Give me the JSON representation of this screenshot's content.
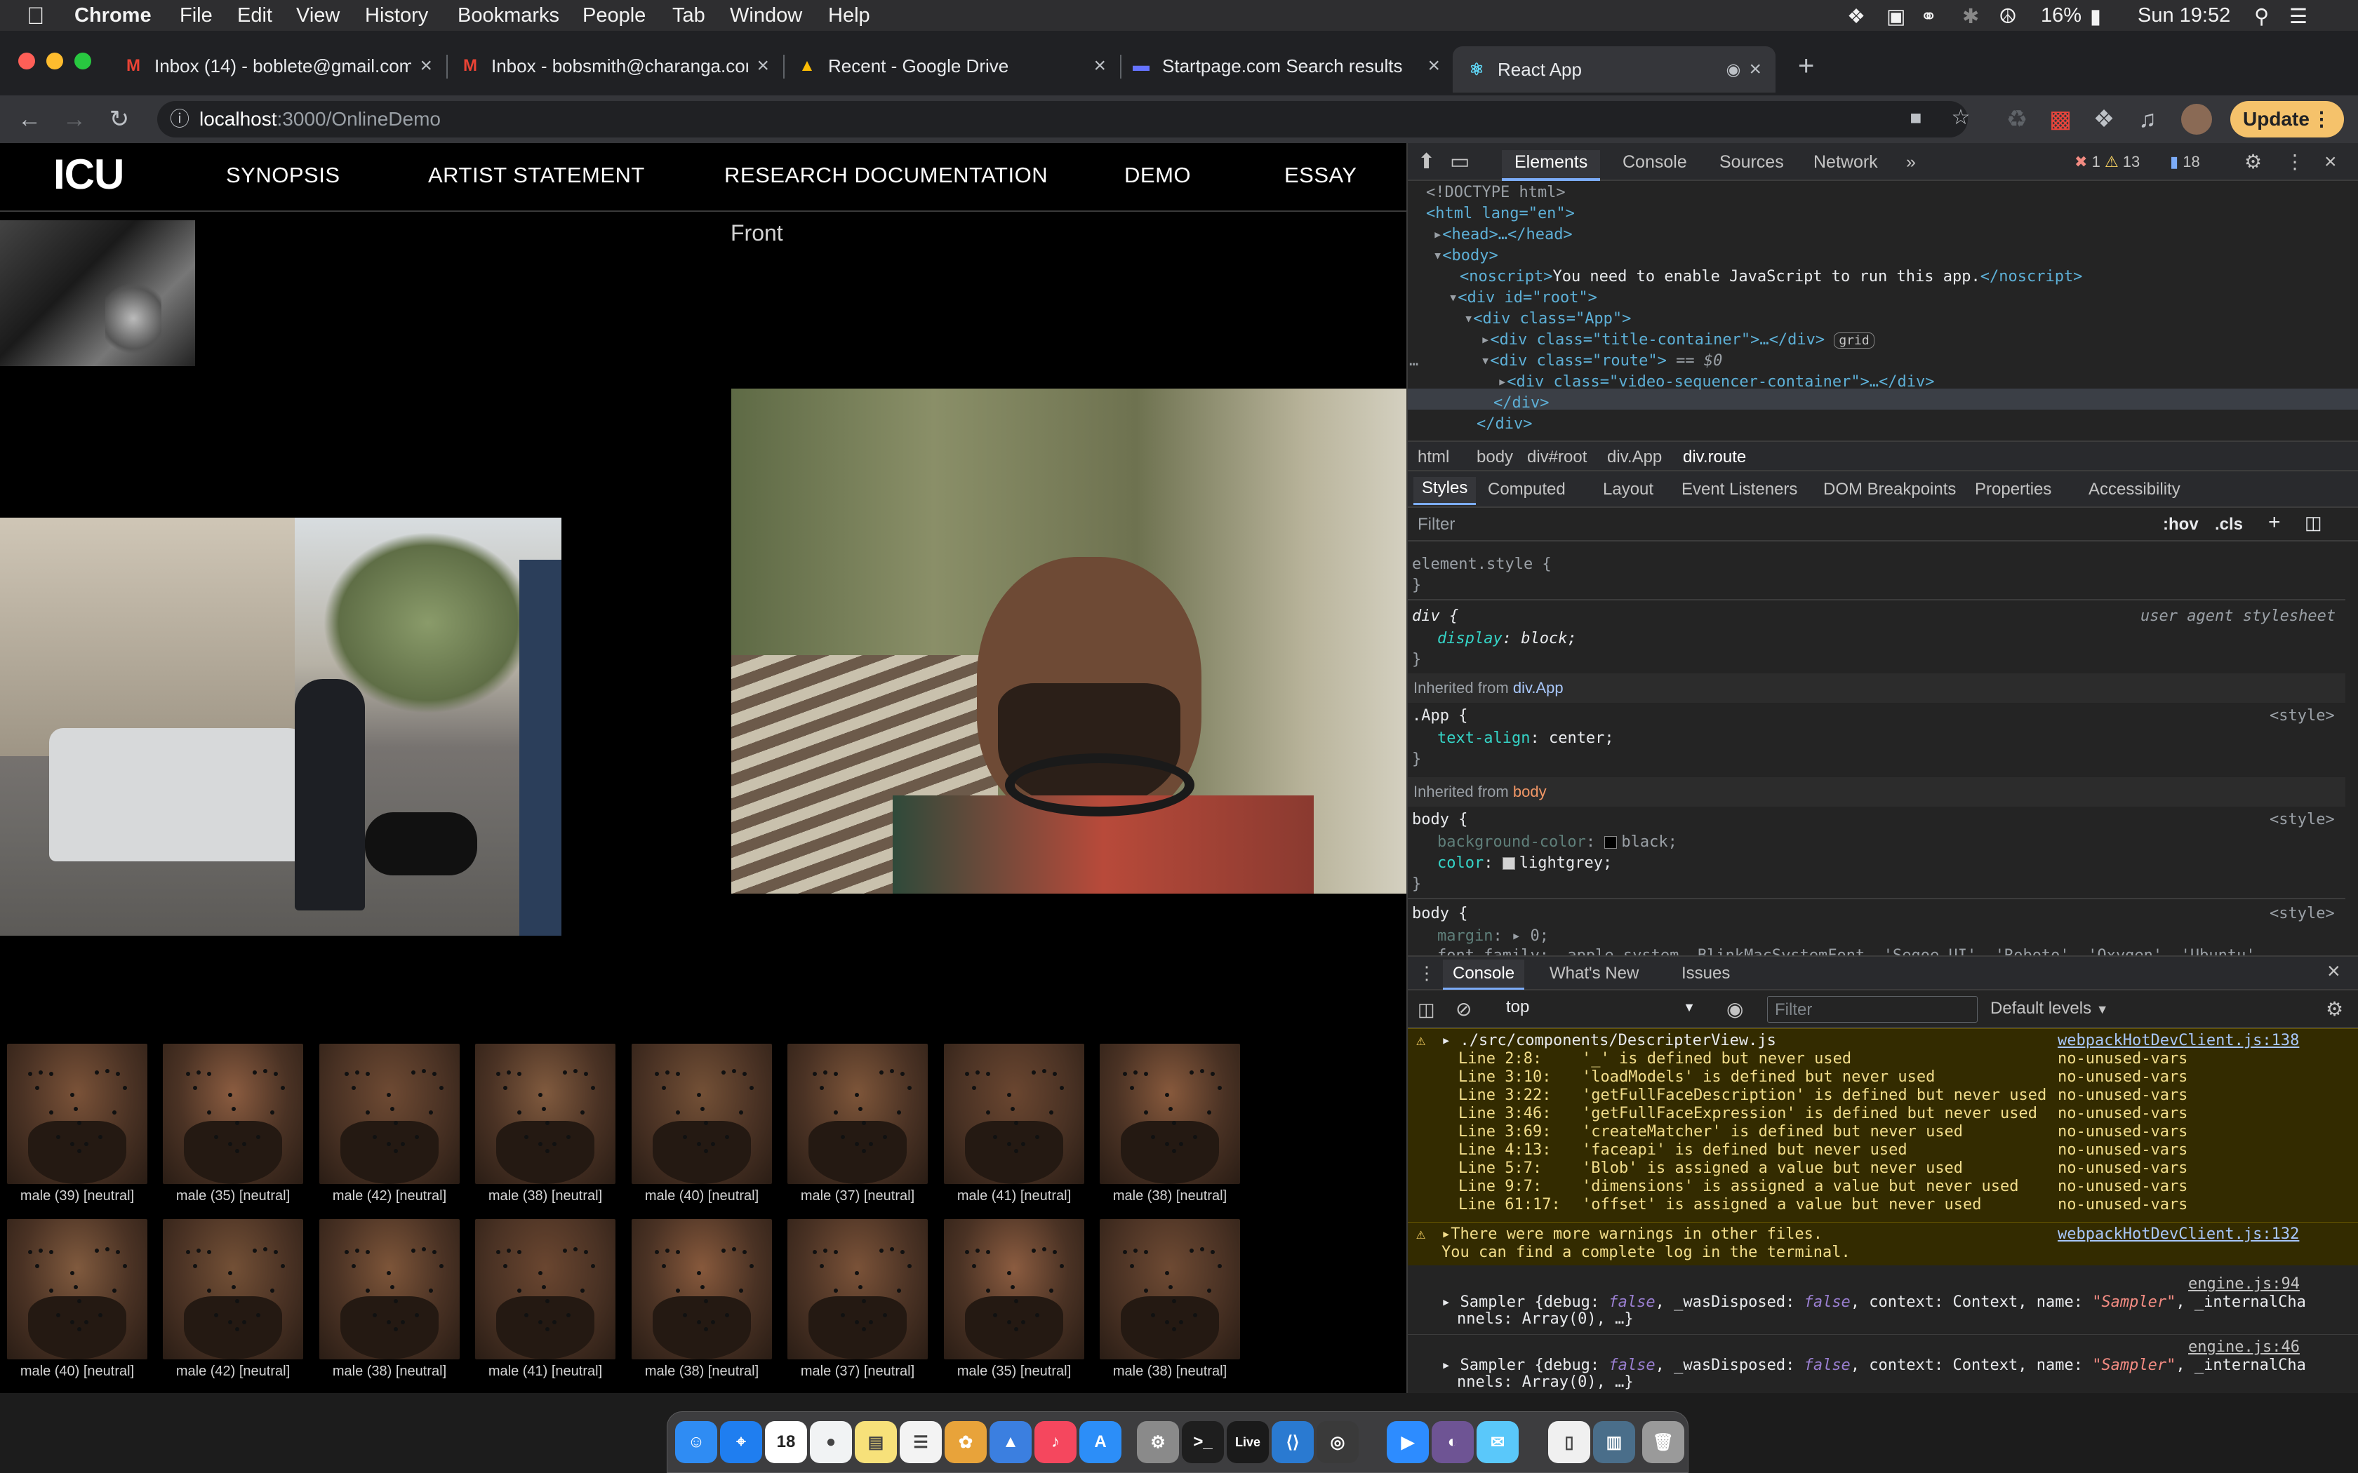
{
  "menubar": {
    "app": "Chrome",
    "items": [
      "File",
      "Edit",
      "View",
      "History",
      "Bookmarks",
      "People",
      "Tab",
      "Window",
      "Help"
    ],
    "battery": "16%",
    "clock": "Sun 19:52"
  },
  "tabs": [
    {
      "title": "Inbox (14) - boblete@gmail.com",
      "icon": "gmail-icon"
    },
    {
      "title": "Inbox - bobsmith@charanga.com",
      "icon": "gmail-icon"
    },
    {
      "title": "Recent - Google Drive",
      "icon": "google-drive-icon"
    },
    {
      "title": "Startpage.com Search results",
      "icon": "startpage-icon"
    },
    {
      "title": "React App",
      "icon": "react-icon",
      "active": true
    }
  ],
  "address": {
    "host": "localhost",
    "path": ":3000/OnlineDemo"
  },
  "update_label": "Update",
  "site": {
    "logo": "ICU",
    "nav": [
      "SYNOPSIS",
      "ARTIST STATEMENT",
      "RESEARCH DOCUMENTATION",
      "DEMO",
      "ESSAY"
    ],
    "front_label": "Front",
    "faces_row1": [
      "male (39) [neutral]",
      "male (35) [neutral]",
      "male (42) [neutral]",
      "male (38) [neutral]",
      "male (40) [neutral]",
      "male (37) [neutral]",
      "male (41) [neutral]",
      "male (38) [neutral]"
    ],
    "faces_row2": [
      "male (40) [neutral]",
      "male (42) [neutral]",
      "male (38) [neutral]",
      "male (41) [neutral]",
      "male (38) [neutral]",
      "male (37) [neutral]",
      "male (35) [neutral]",
      "male (38) [neutral]"
    ]
  },
  "devtools": {
    "tabs": [
      "Elements",
      "Console",
      "Sources",
      "Network",
      "»"
    ],
    "counts": {
      "errors": "1",
      "warnings": "13",
      "messages": "18"
    },
    "dom": {
      "doctype": "<!DOCTYPE html>",
      "html_open": "<html lang=\"en\">",
      "head": "<head>…</head>",
      "body_open": "<body>",
      "noscript_text": "You need to enable JavaScript to run this app.",
      "div_root": "<div id=\"root\">",
      "div_app": "<div class=\"App\">",
      "title_container": "<div class=\"title-container\">…</div>",
      "grid_badge": "grid",
      "route": "<div class=\"route\">",
      "route_suffix": " == $0",
      "video_seq": "<div class=\"video-sequencer-container\">…</div>",
      "close_div": "</div>",
      "close_div2": "</div>"
    },
    "breadcrumbs": [
      "html",
      "body",
      "div#root",
      "div.App",
      "div.route"
    ],
    "subtabs": [
      "Styles",
      "Computed",
      "Layout",
      "Event Listeners",
      "DOM Breakpoints",
      "Properties",
      "Accessibility"
    ],
    "filter_placeholder": "Filter",
    "hov": ":hov",
    "cls": ".cls",
    "styles": {
      "element_style": "element.style {",
      "close": "}",
      "div_sel": "div {",
      "ua": "user agent stylesheet",
      "display": "display",
      "display_val": "block;",
      "inherited_app": "Inherited from",
      "inherited_app_sel": "div.App",
      "app_sel": ".App {",
      "style_src": "<style>",
      "text_align": "text-align",
      "text_align_val": "center;",
      "inherited_body": "Inherited from",
      "inherited_body_sel": "body",
      "body_sel": "body {",
      "bgcolor": "background-color",
      "bgcolor_val": "black;",
      "color": "color",
      "color_val": "lightgrey;",
      "margin": "margin",
      "margin_val": "0;",
      "font_family": "font-family: -apple-system, BlinkMacSystemFont, 'Segoe UI', 'Roboto', 'Oxygen', 'Ubuntu',"
    },
    "drawer_tabs": [
      "Console",
      "What's New",
      "Issues"
    ],
    "console_context": "top",
    "console_filter": "Filter",
    "levels": "Default levels",
    "warning1": {
      "file": "./src/components/DescripterView.js",
      "src": "webpackHotDevClient.js:138",
      "lines": [
        [
          "Line 2:8:",
          "'_' is defined but never used",
          "no-unused-vars"
        ],
        [
          "Line 3:10:",
          "'loadModels' is defined but never used",
          "no-unused-vars"
        ],
        [
          "Line 3:22:",
          "'getFullFaceDescription' is defined but never used",
          "no-unused-vars"
        ],
        [
          "Line 3:46:",
          "'getFullFaceExpression' is defined but never used",
          "no-unused-vars"
        ],
        [
          "Line 3:69:",
          "'createMatcher' is defined but never used",
          "no-unused-vars"
        ],
        [
          "Line 4:13:",
          "'faceapi' is defined but never used",
          "no-unused-vars"
        ],
        [
          "Line 5:7:",
          "'Blob' is assigned a value but never used",
          "no-unused-vars"
        ],
        [
          "Line 9:7:",
          "'dimensions' is assigned a value but never used",
          "no-unused-vars"
        ],
        [
          "Line 61:17:",
          "'offset' is assigned a value but never used",
          "no-unused-vars"
        ]
      ]
    },
    "warning2": {
      "line1": "There were more warnings in other files.",
      "line2": "You can find a complete log in the terminal.",
      "src": "webpackHotDevClient.js:132"
    },
    "logs": [
      {
        "src": "engine.js:94",
        "l1a": "Sampler {debug: ",
        "l1b": "false",
        "l1c": ", _wasDisposed: ",
        "l1d": "false",
        "l1e": ", context: Context, name: ",
        "l1f": "\"Sampler\"",
        "l1g": ", _internalCha",
        "l2": "nnels: Array(0), …}"
      },
      {
        "src": "engine.js:46",
        "l1a": "Sampler {debug: ",
        "l1b": "false",
        "l1c": ", _wasDisposed: ",
        "l1d": "false",
        "l1e": ", context: Context, name: ",
        "l1f": "\"Sampler\"",
        "l1g": ", _internalCha",
        "l2": "nnels: Array(0), …}"
      }
    ]
  },
  "dock": {
    "apps": [
      "finder-icon",
      "safari-icon",
      "calendar-icon",
      "chrome-icon",
      "notes-icon",
      "reminders-icon",
      "photos-icon",
      "keynote-icon",
      "music-icon",
      "app-store-icon",
      "system-preferences-icon",
      "terminal-icon",
      "ableton-live-icon",
      "vscode-icon",
      "obs-icon",
      "zoom-icon",
      "github-desktop-icon",
      "messages-icon",
      "document-icon",
      "downloads-icon",
      "trash-icon"
    ],
    "calendar_day": "18",
    "live_label": "Live"
  }
}
